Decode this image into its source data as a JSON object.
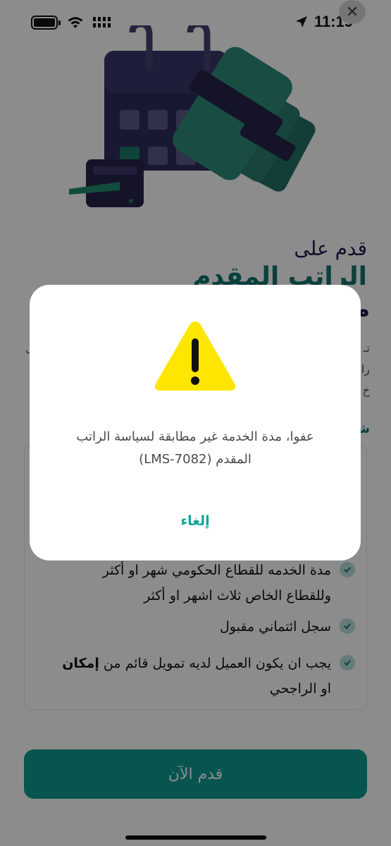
{
  "status_bar": {
    "time": "11:19",
    "close_symbol": "✕"
  },
  "hero": {
    "icons": [
      "calendar-icon",
      "money-bundles-icon",
      "card-terminal-icon"
    ]
  },
  "promo": {
    "eyebrow": "قدم على",
    "headline": "الراتب المقدم",
    "headline_partial": "م",
    "desc_fragments": [
      "تـ",
      "را",
      "خ",
      "شـ"
    ],
    "desc_left": "ل"
  },
  "requirements": [
    {
      "text": "مدة الخدمه للقطاع الحكومي شهر او أكثر وللقطاع الخاص ثلاث اشهر او أكثر"
    },
    {
      "text": "سجل ائتماني مقبول"
    },
    {
      "text_prefix": "يجب ان يكون العميل لديه تمويل قائم من ",
      "text_bold": "إمكان",
      "text_suffix": " او الراجحي"
    }
  ],
  "cta": {
    "label": "قدم الآن"
  },
  "dialog": {
    "message_line1": "عفوا، مدة الخدمة غير مطابقة لسياسة الراتب",
    "message_line2": "المقدم (LMS-7082)",
    "cancel_label": "إلغاء",
    "icon": "warning-icon"
  },
  "colors": {
    "accent": "#0f9c92",
    "brand_navy": "#1e1b4b",
    "warning_yellow": "#ffe600",
    "overlay": "rgba(0,0,0,0.45)"
  }
}
